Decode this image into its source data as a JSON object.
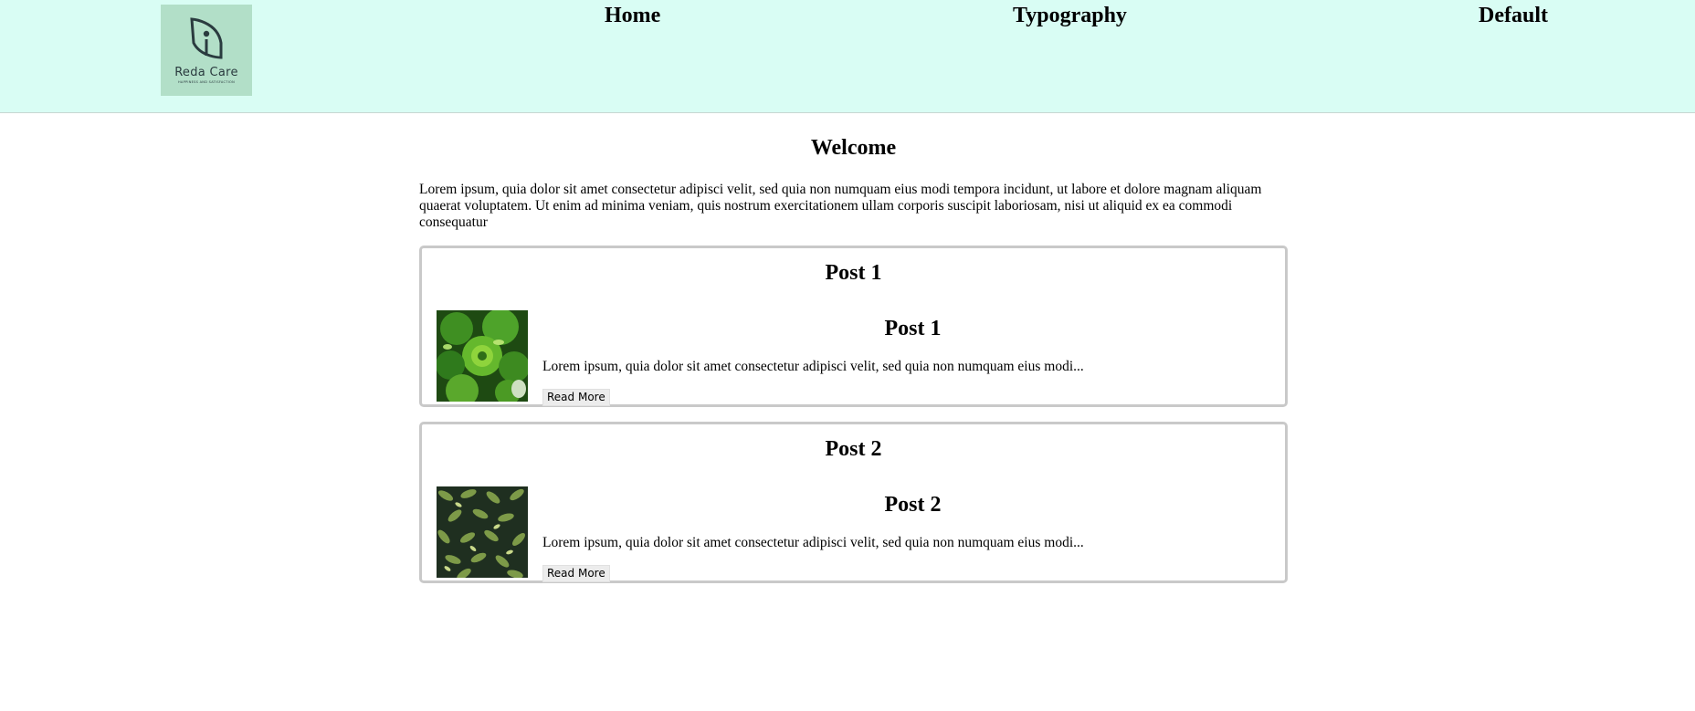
{
  "header": {
    "logo": {
      "name": "Reda Care",
      "tagline": "HAPPINESS AND SATISFACTION"
    },
    "nav": [
      {
        "label": "Home"
      },
      {
        "label": "Typography"
      },
      {
        "label": "Default"
      }
    ],
    "background_color": "#d9fdf4"
  },
  "main": {
    "title": "Welcome",
    "intro": "Lorem ipsum, quia dolor sit amet consectetur adipisci velit, sed quia non numquam eius modi tempora incidunt, ut labore et dolore magnam aliquam quaerat voluptatem. Ut enim ad minima veniam, quis nostrum exercitationem ullam corporis suscipit laboriosam, nisi ut aliquid ex ea commodi consequatur",
    "posts": [
      {
        "card_title": "Post 1",
        "heading": "Post 1",
        "excerpt": "Lorem ipsum, quia dolor sit amet consectetur adipisci velit, sed quia non numquam eius modi...",
        "read_more_label": "Read More",
        "image": "green-succulent-plants-photo"
      },
      {
        "card_title": "Post 2",
        "heading": "Post 2",
        "excerpt": "Lorem ipsum, quia dolor sit amet consectetur adipisci velit, sed quia non numquam eius modi...",
        "read_more_label": "Read More",
        "image": "dark-green-leaves-photo"
      }
    ]
  }
}
